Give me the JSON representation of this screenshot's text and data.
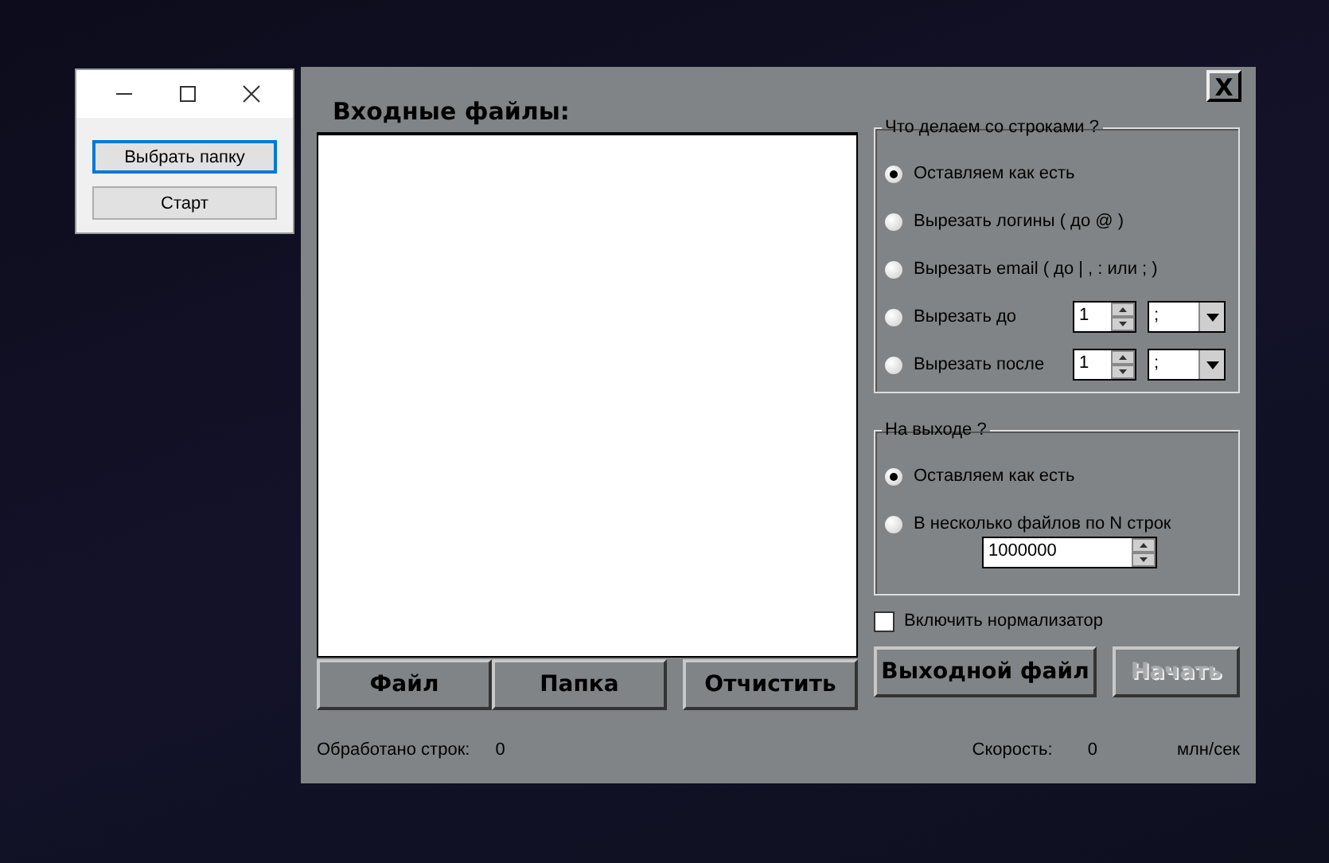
{
  "small_window": {
    "buttons": [
      {
        "label": "Выбрать папку",
        "focused": true
      },
      {
        "label": "Старт",
        "focused": false
      }
    ]
  },
  "main_window": {
    "close_label": "X",
    "input_title": "Входные файлы:",
    "lines_group": {
      "title": "Что делаем со строками ?",
      "options": [
        {
          "kind": "plain",
          "label": "Оставляем как есть",
          "selected": true
        },
        {
          "kind": "plain",
          "label": "Вырезать логины ( до @ )",
          "selected": false
        },
        {
          "kind": "plain",
          "label": "Вырезать email ( до | , : или ; )",
          "selected": false
        },
        {
          "kind": "spin",
          "label": "Вырезать до",
          "selected": false,
          "count": "1",
          "separator": ";"
        },
        {
          "kind": "spin",
          "label": "Вырезать после",
          "selected": false,
          "count": "1",
          "separator": ";"
        }
      ]
    },
    "output_group": {
      "title": "На выходе ?",
      "options": [
        {
          "kind": "plain",
          "label": "Оставляем как есть",
          "selected": true
        },
        {
          "kind": "field",
          "label": "В несколько файлов по N строк",
          "selected": false,
          "value": "1000000"
        }
      ]
    },
    "normalizer": {
      "label": "Включить нормализатор",
      "checked": false
    },
    "left_buttons": [
      {
        "label": "Файл",
        "disabled": false
      },
      {
        "label": "Папка",
        "disabled": false
      },
      {
        "label": "Отчистить",
        "disabled": false
      }
    ],
    "right_buttons": [
      {
        "label": "Выходной файл",
        "disabled": false
      },
      {
        "label": "Начать",
        "disabled": true
      }
    ],
    "status": {
      "processed_label": "Обработано строк:",
      "processed_value": "0",
      "speed_label": "Скорость:",
      "speed_value": "0",
      "speed_unit": "млн/сек"
    }
  }
}
